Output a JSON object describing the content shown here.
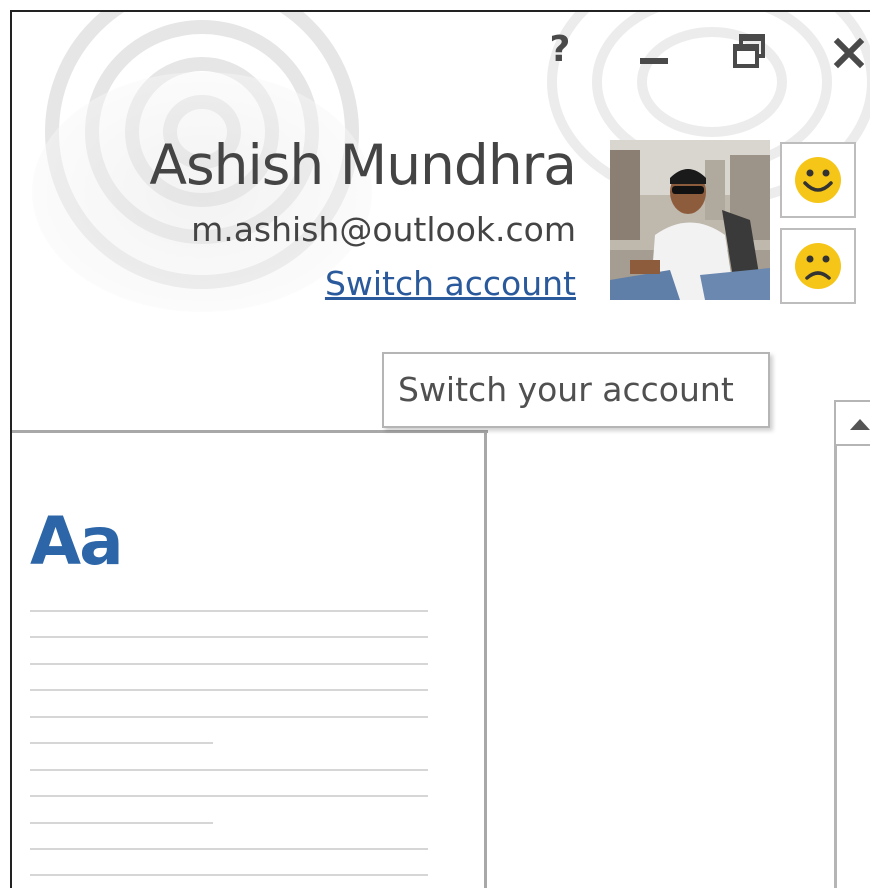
{
  "window_controls": {
    "help": "?",
    "help_icon": "question-mark-icon",
    "minimize_icon": "minimize-icon",
    "restore_icon": "restore-icon",
    "close_icon": "close-icon"
  },
  "account": {
    "name": "Ashish Mundhra",
    "email": "m.ashish@outlook.com",
    "switch_link": "Switch account",
    "avatar": "profile-photo"
  },
  "feedback": {
    "smile_icon": "smiley-face-icon",
    "frown_icon": "frown-face-icon"
  },
  "tooltip": {
    "text": "Switch your account"
  },
  "gallery": {
    "style_preview": "Aa"
  },
  "colors": {
    "accent": "#2c66a8",
    "link": "#2a5a9c",
    "text": "#444444",
    "emoji_yellow": "#f5c518"
  }
}
